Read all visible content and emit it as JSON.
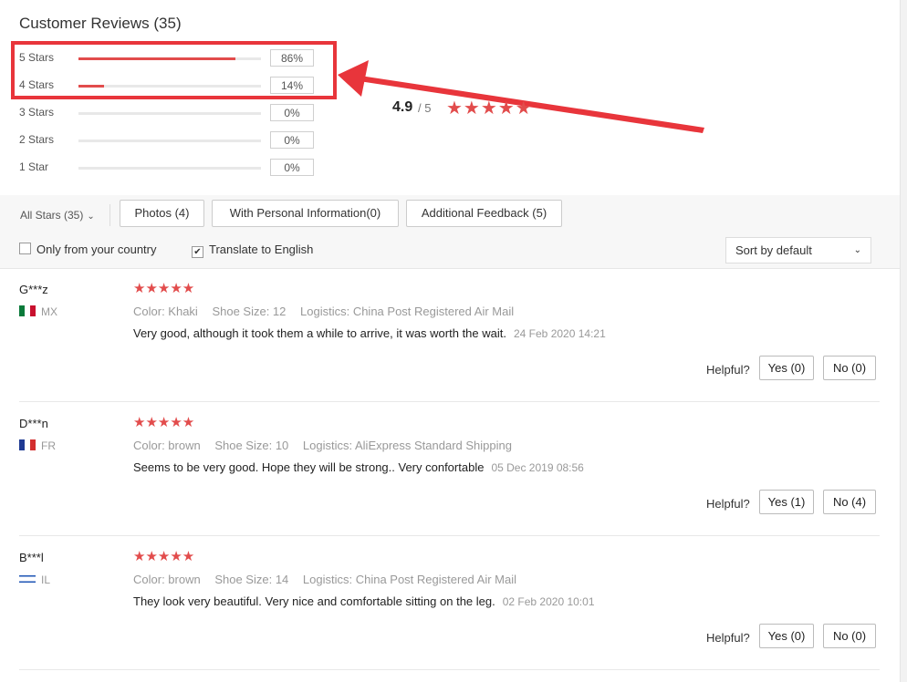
{
  "header": {
    "title": "Customer Reviews (35)"
  },
  "distribution": [
    {
      "label": "5 Stars",
      "pct": "86%",
      "fraction": 0.86
    },
    {
      "label": "4 Stars",
      "pct": "14%",
      "fraction": 0.14
    },
    {
      "label": "3 Stars",
      "pct": "0%",
      "fraction": 0
    },
    {
      "label": "2 Stars",
      "pct": "0%",
      "fraction": 0
    },
    {
      "label": "1 Star",
      "pct": "0%",
      "fraction": 0
    }
  ],
  "rating": {
    "average": "4.9",
    "of": "/ 5",
    "stars": "★★★★★"
  },
  "filters": {
    "all_stars": "All Stars (35)",
    "photos": "Photos (4)",
    "personal_info": "With Personal Information(0)",
    "additional_feedback": "Additional Feedback (5)",
    "only_country": "Only from your country",
    "translate": "Translate to English",
    "translate_checked": true,
    "only_country_checked": false,
    "sort": "Sort by default"
  },
  "reviews": [
    {
      "name": "G***z",
      "country": "MX",
      "stars": "★★★★★",
      "color": "Color: Khaki",
      "size": "Shoe Size: 12",
      "logistics": "Logistics: China Post Registered Air Mail",
      "text": "Very good, although it took them a while to arrive, it was worth the wait.",
      "date": "24 Feb 2020 14:21",
      "helpful": "Helpful?",
      "yes": "Yes (0)",
      "no": "No (0)"
    },
    {
      "name": "D***n",
      "country": "FR",
      "stars": "★★★★★",
      "color": "Color: brown",
      "size": "Shoe Size: 10",
      "logistics": "Logistics: AliExpress Standard Shipping",
      "text": "Seems to be very good. Hope they will be strong.. Very confortable",
      "date": "05 Dec 2019 08:56",
      "helpful": "Helpful?",
      "yes": "Yes (1)",
      "no": "No (4)"
    },
    {
      "name": "B***l",
      "country": "IL",
      "stars": "★★★★★",
      "color": "Color: brown",
      "size": "Shoe Size: 14",
      "logistics": "Logistics: China Post Registered Air Mail",
      "text": "They look very beautiful. Very nice and comfortable sitting on the leg.",
      "date": "02 Feb 2020 10:01",
      "helpful": "Helpful?",
      "yes": "Yes (0)",
      "no": "No (0)"
    }
  ],
  "colors": {
    "accent": "#e24c4c",
    "highlight": "#e8353b"
  }
}
